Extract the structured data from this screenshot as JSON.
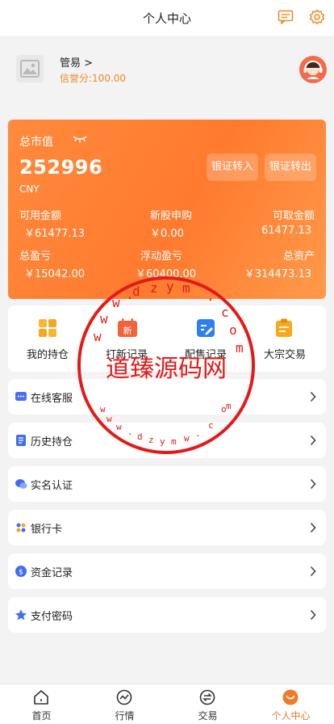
{
  "header": {
    "title": "个人中心"
  },
  "profile": {
    "name": "管易 >",
    "credit": "信誉分:100.00"
  },
  "asset": {
    "label": "总市值",
    "total": "252996",
    "currency": "CNY",
    "transfer_in": "银证转入",
    "transfer_out": "银证转出",
    "stats": [
      {
        "label": "可用金额",
        "value": "￥61477.13"
      },
      {
        "label": "新股申购",
        "value": "￥0.00"
      },
      {
        "label": "可取金额",
        "value": "61477.13"
      },
      {
        "label": "总盈亏",
        "value": "￥15042.00"
      },
      {
        "label": "浮动盈亏",
        "value": "￥60400.00"
      },
      {
        "label": "总资产",
        "value": "￥314473.13"
      }
    ]
  },
  "quick_actions": [
    {
      "label": "我的持仓",
      "icon": "grid-icon"
    },
    {
      "label": "打新记录",
      "icon": "calendar-new-icon"
    },
    {
      "label": "配售记录",
      "icon": "edit-doc-icon"
    },
    {
      "label": "大宗交易",
      "icon": "clipboard-icon"
    }
  ],
  "menu": [
    {
      "label": "在线客服",
      "icon": "chat-icon"
    },
    {
      "label": "历史持仓",
      "icon": "document-icon"
    },
    {
      "label": "实名认证",
      "icon": "bubble-icon"
    },
    {
      "label": "银行卡",
      "icon": "card-icon"
    },
    {
      "label": "资金记录",
      "icon": "money-icon"
    },
    {
      "label": "支付密码",
      "icon": "star-icon"
    }
  ],
  "watermark": {
    "text": "道臻源码网",
    "url": "www.dzym.com"
  },
  "tabs": [
    {
      "label": "首页",
      "icon": "home-icon"
    },
    {
      "label": "行情",
      "icon": "chart-icon"
    },
    {
      "label": "交易",
      "icon": "exchange-icon"
    },
    {
      "label": "个人中心",
      "icon": "user-icon"
    }
  ],
  "colors": {
    "accent": "#f07b26",
    "card": "#ff8a3d",
    "background": "#f3f3f3"
  }
}
